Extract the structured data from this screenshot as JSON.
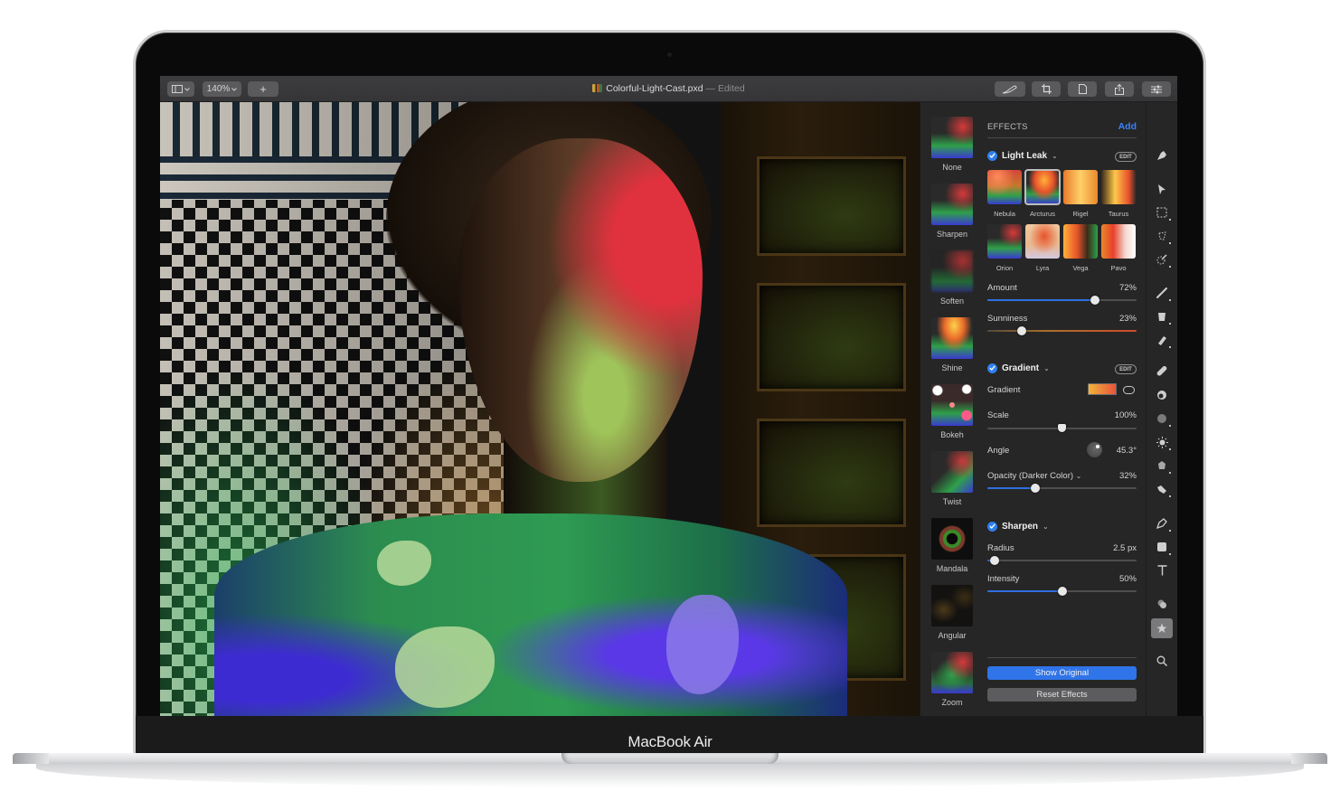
{
  "device": {
    "brand_label": "MacBook Air"
  },
  "titlebar": {
    "zoom_value": "140%",
    "add_label": "+",
    "document_name": "Colorful-Light-Cast.pxd",
    "separator": " — ",
    "document_status": "Edited",
    "left_icons": [
      "sidebar-toggle-icon",
      "zoom-dropdown",
      "plus-icon"
    ],
    "right_icons": [
      "brush-icon",
      "crop-icon",
      "document-icon",
      "share-icon",
      "adjustments-icon"
    ]
  },
  "effects_browser": {
    "items": [
      {
        "label": "None"
      },
      {
        "label": "Sharpen"
      },
      {
        "label": "Soften"
      },
      {
        "label": "Shine"
      },
      {
        "label": "Bokeh"
      },
      {
        "label": "Twist"
      },
      {
        "label": "Mandala"
      },
      {
        "label": "Angular"
      },
      {
        "label": "Zoom"
      }
    ]
  },
  "panel": {
    "header": "EFFECTS",
    "add_label": "Add",
    "edit_label": "EDIT",
    "light_leak": {
      "title": "Light Leak",
      "enabled": true,
      "presets": [
        {
          "label": "Nebula"
        },
        {
          "label": "Arcturus",
          "selected": true
        },
        {
          "label": "Rigel"
        },
        {
          "label": "Taurus"
        },
        {
          "label": "Orion"
        },
        {
          "label": "Lyra"
        },
        {
          "label": "Vega"
        },
        {
          "label": "Pavo"
        }
      ],
      "amount": {
        "label": "Amount",
        "value": "72%",
        "fraction": 0.72
      },
      "sunniness": {
        "label": "Sunniness",
        "value": "23%",
        "fraction": 0.23
      }
    },
    "gradient": {
      "title": "Gradient",
      "enabled": true,
      "gradient_label": "Gradient",
      "gradient_colors": [
        "#f2b33a",
        "#e8543c"
      ],
      "scale": {
        "label": "Scale",
        "value": "100%",
        "fraction": 0.5
      },
      "angle": {
        "label": "Angle",
        "value": "45.3°"
      },
      "opacity": {
        "label": "Opacity (Darker Color)",
        "value": "32%",
        "fraction": 0.32
      }
    },
    "sharpen": {
      "title": "Sharpen",
      "enabled": true,
      "radius": {
        "label": "Radius",
        "value": "2.5 px",
        "fraction": 0.05
      },
      "intensity": {
        "label": "Intensity",
        "value": "50%",
        "fraction": 0.5
      }
    },
    "show_original_label": "Show Original",
    "reset_effects_label": "Reset Effects"
  },
  "tools": [
    "arrange-icon",
    "pointer-icon",
    "rect-select-icon",
    "lasso-icon",
    "quick-select-icon",
    "paint-brush-icon",
    "bucket-icon",
    "eraser-icon",
    "heal-icon",
    "clone-icon",
    "blur-icon",
    "light-icon",
    "retouch-icon",
    "smudge-icon",
    "pen-icon",
    "shape-icon",
    "text-icon",
    "color-adjust-icon",
    "effects-icon",
    "zoom-icon"
  ],
  "colors": {
    "accent": "#2f74e8",
    "panel_bg": "#262626",
    "titlebar_bg": "#3a3a3c"
  }
}
